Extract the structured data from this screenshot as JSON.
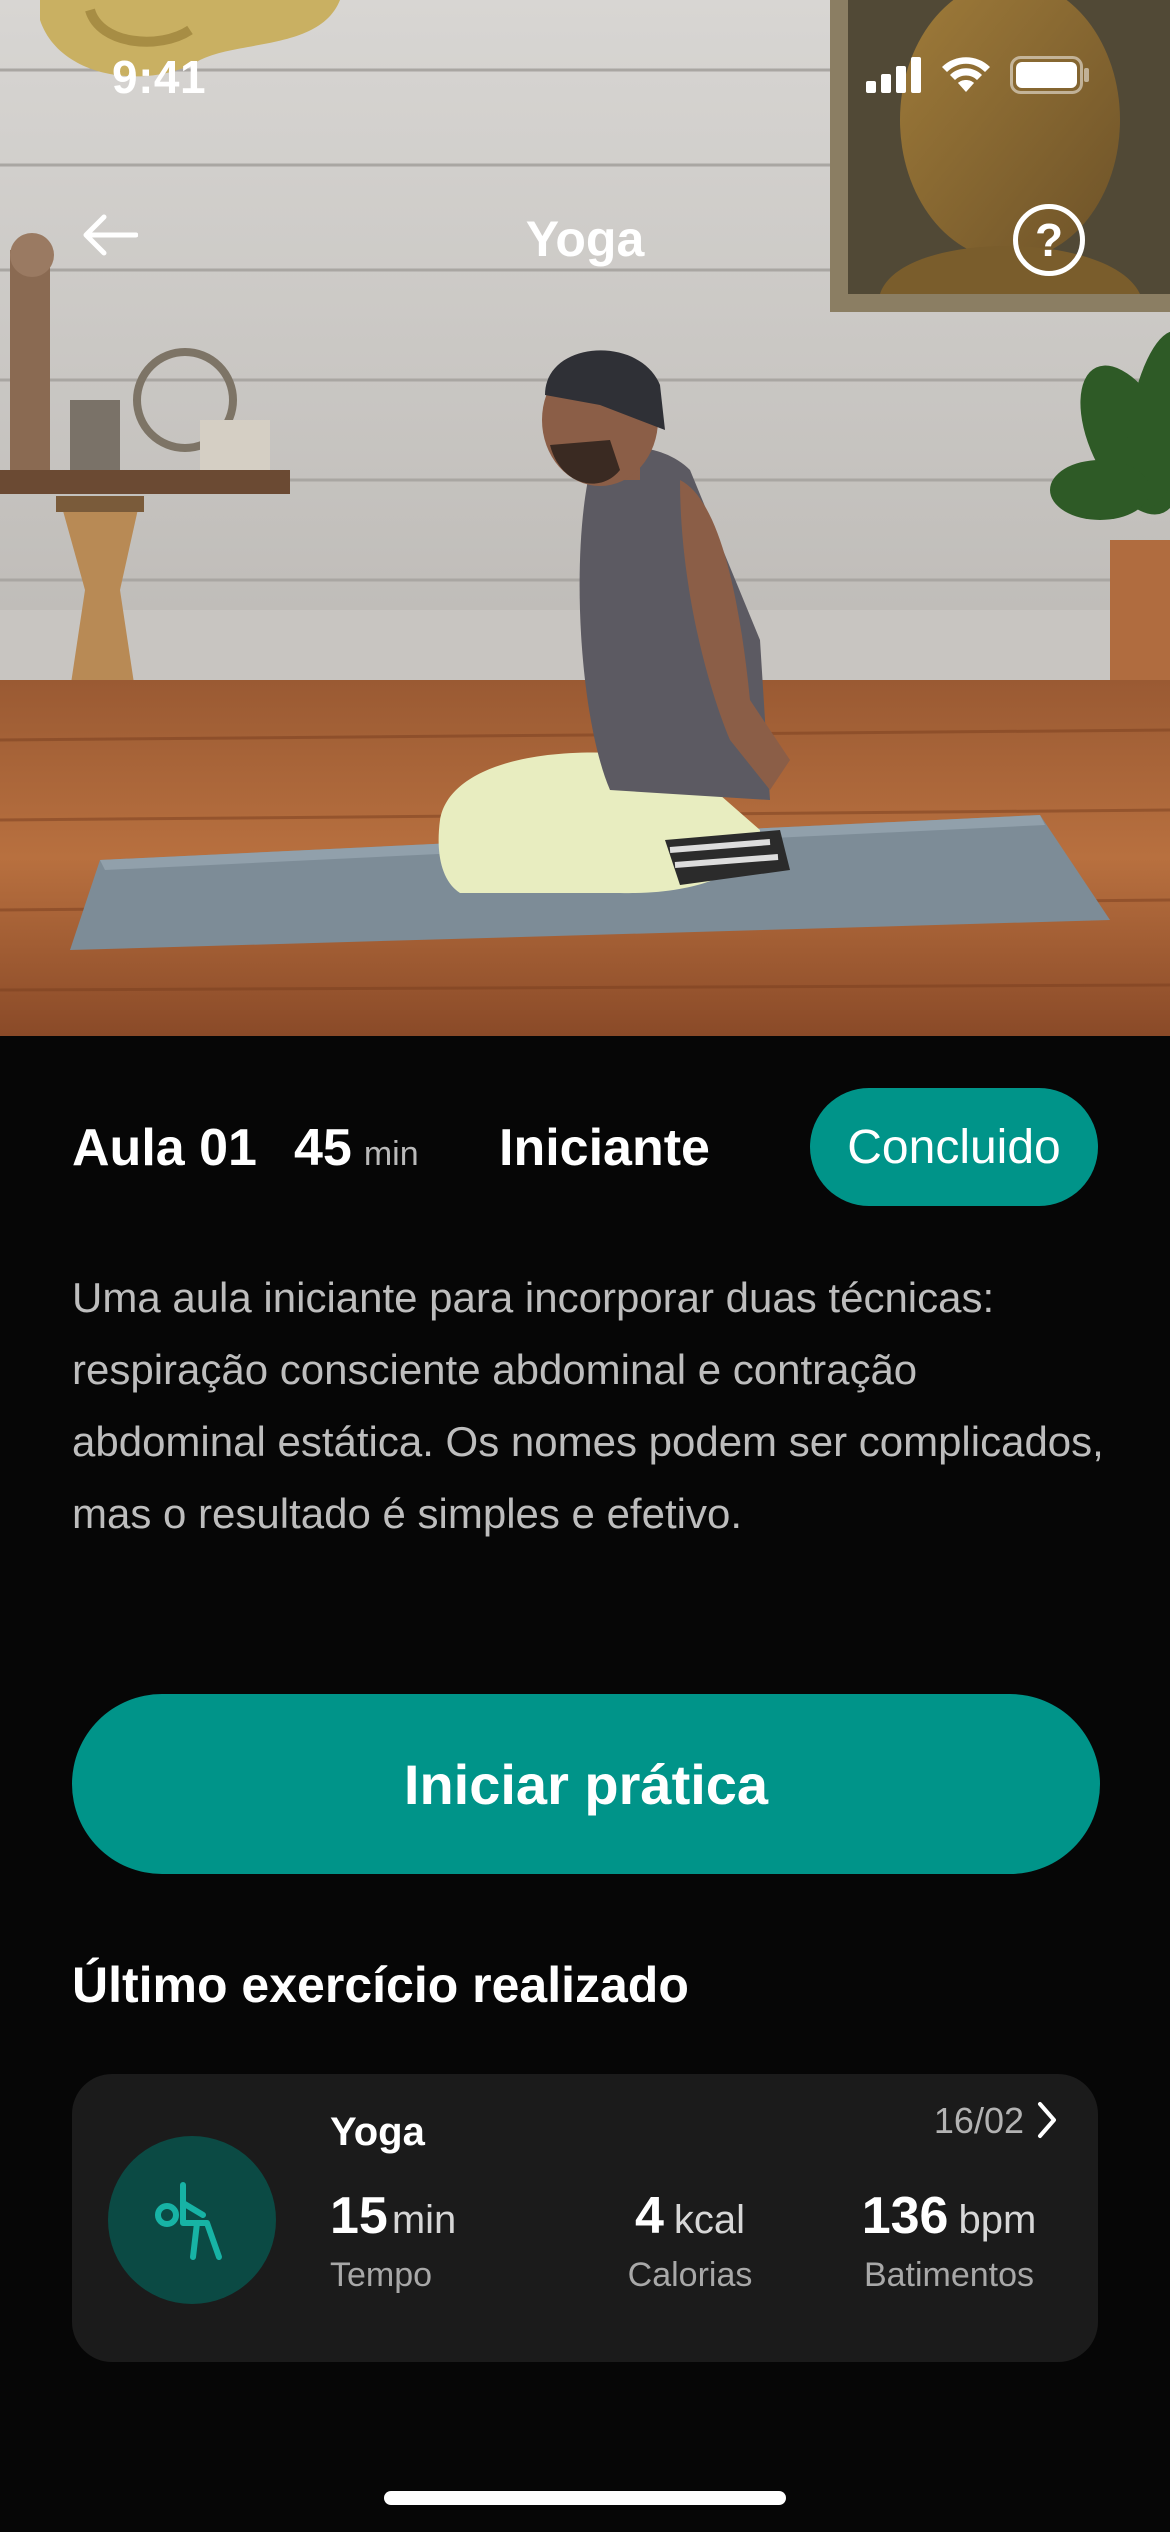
{
  "status_bar": {
    "time": "9:41",
    "icons": [
      "cellular-signal-icon",
      "wifi-icon",
      "battery-icon"
    ]
  },
  "nav": {
    "back_icon": "arrow-left-icon",
    "title": "Yoga",
    "help_icon": "question-circle-icon",
    "help_symbol": "?"
  },
  "hero": {
    "image_description_icon": "yoga-video-thumbnail"
  },
  "lesson": {
    "number": "Aula 01",
    "duration_value": "45",
    "duration_unit": "min",
    "level": "Iniciante",
    "status": "Concluido",
    "description": "Uma aula iniciante para incorporar duas técnicas: respiração consciente abdominal e contração abdominal estática. Os nomes podem ser complicados, mas o resultado é simples e efetivo."
  },
  "actions": {
    "start_label": "Iniciar prática"
  },
  "last_workout": {
    "section_title": "Último exercício realizado",
    "name": "Yoga",
    "date": "16/02",
    "icon": "yoga-pose-icon",
    "stats": [
      {
        "value": "15",
        "unit": "min",
        "label": "Tempo"
      },
      {
        "value": "4",
        "unit": "kcal",
        "label": "Calorias"
      },
      {
        "value": "136",
        "unit": "bpm",
        "label": "Batimentos"
      }
    ]
  },
  "colors": {
    "accent": "#009489",
    "background": "#060606",
    "card": "#1b1b1b",
    "icon_circle": "#0b4a44",
    "icon_stroke": "#17b3a5"
  }
}
